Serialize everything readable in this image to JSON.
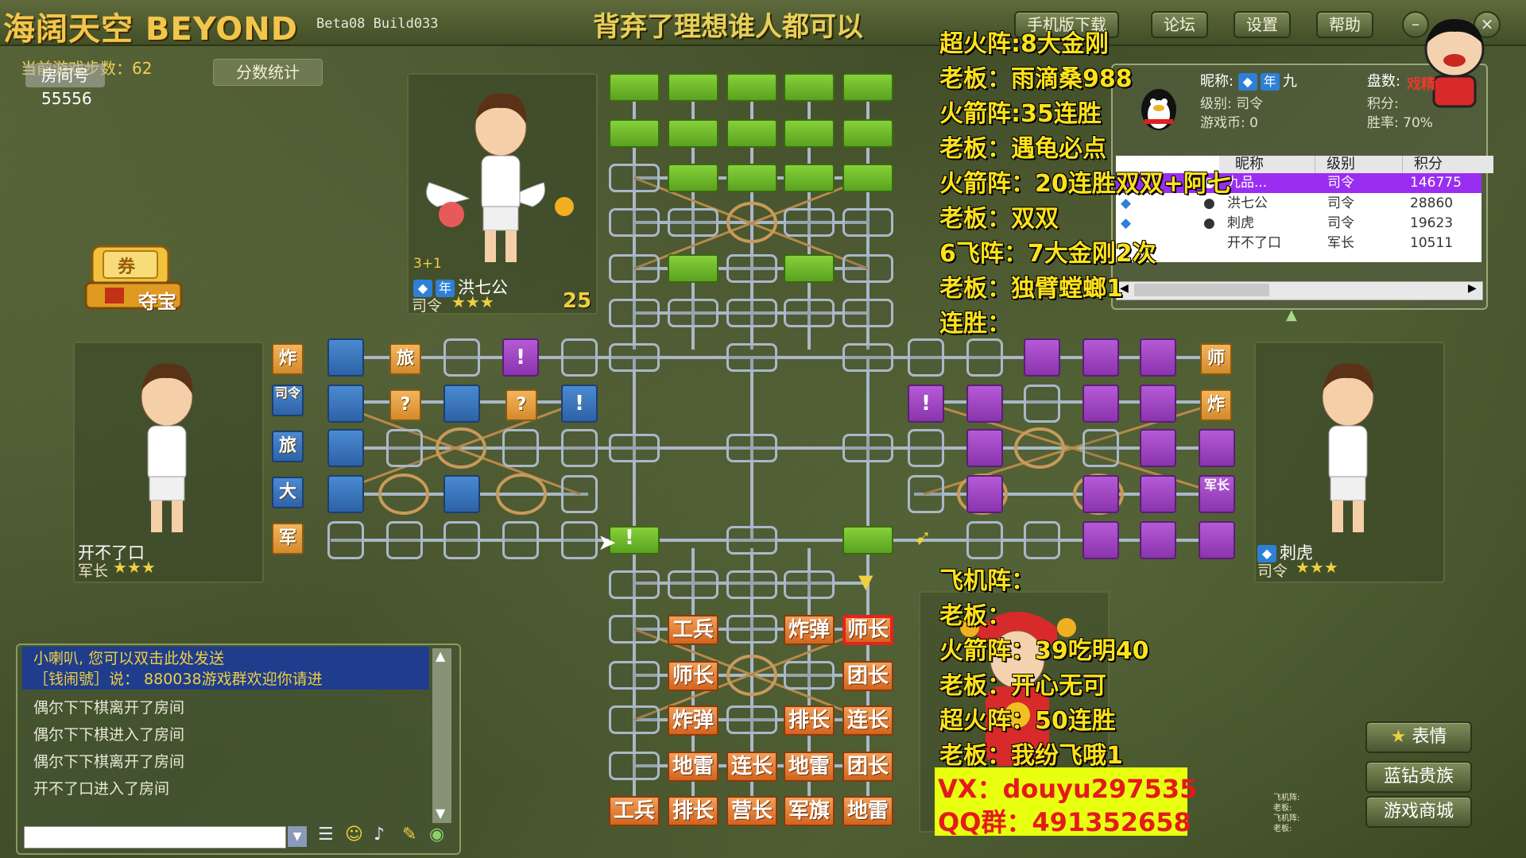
{
  "app": {
    "title": "海阔天空  BEYOND",
    "subtitle": "Beta08 Build033",
    "banner": "背弃了理想谁人都可以",
    "buttons": [
      "手机版下载",
      "论坛",
      "设置",
      "帮助"
    ]
  },
  "room": {
    "steps_label": "当前游戏步数：62",
    "room_label": "房间号",
    "room_number": "55556",
    "score_button": "分数统计",
    "treasure_label": "夺宝",
    "treasure_top": "券"
  },
  "players": {
    "top": {
      "name": "洪七公",
      "rank": "司令",
      "level": "3+1",
      "timer": "25",
      "badge": "年"
    },
    "left": {
      "name": "开不了口",
      "rank": "军长"
    },
    "right": {
      "name": "刺虎",
      "rank": "司令"
    }
  },
  "board": {
    "bottom_rows": [
      [
        "",
        "工兵",
        "",
        "炸弹",
        "师长"
      ],
      [
        "",
        "师长",
        "",
        "",
        "团长"
      ],
      [
        "",
        "炸弹",
        "",
        "排长",
        "连长"
      ],
      [
        "",
        "地雷",
        "连长",
        "地雷",
        "团长"
      ],
      [
        "工兵",
        "排长",
        "营长",
        "军旗",
        "地雷"
      ]
    ],
    "left_tiles": [
      "炸",
      "司令",
      "旅",
      "大",
      "军"
    ],
    "left_row1": [
      "旅",
      "!"
    ],
    "left_row2": [
      "?",
      "?",
      "!"
    ],
    "right_tiles": [
      "师",
      "炸",
      "",
      "军长"
    ],
    "right_mark": "!",
    "center_mark": "!"
  },
  "chat": {
    "line1": "小喇叭, 您可以双击此处发送",
    "line2": "［钱闹號］说：  880038游戏群欢迎你请进",
    "messages": [
      "偶尔下下棋离开了房间",
      "偶尔下下棋进入了房间",
      "偶尔下下棋离开了房间",
      "开不了口进入了房间"
    ]
  },
  "profile": {
    "nick_label": "昵称:",
    "nick_value": "九",
    "level_label": "级别: 司令",
    "coins_label": "游戏币: 0",
    "games_label": "盘数:",
    "score_label": "积分:",
    "winrate_label": "胜率: 70%"
  },
  "rank_table": {
    "headers": [
      "昵称",
      "级别",
      "积分"
    ],
    "rows": [
      {
        "name": "九品...",
        "level": "司令",
        "score": "146775"
      },
      {
        "name": "洪七公",
        "level": "司令",
        "score": "28860"
      },
      {
        "name": "刺虎",
        "level": "司令",
        "score": "19623"
      },
      {
        "name": "开不了口",
        "level": "军长",
        "score": "10511"
      }
    ]
  },
  "overlay": {
    "lines_top": [
      "超火阵:8大金刚",
      "老板：雨滴桑988",
      "火箭阵:35连胜",
      "老板：遇龟必点",
      "火箭阵：20连胜双双+阿七",
      "老板：双双",
      "6飞阵：7大金刚2次",
      "老板：独臂螳螂1",
      "连胜："
    ],
    "lines_bottom": [
      "飞机阵：",
      "老板：",
      "火箭阵：39吃明40",
      "老板：开心无可",
      "超火阵：50连胜",
      "老板：我纷飞哦1"
    ],
    "vx": "VX：douyu297535",
    "qq": "QQ群：491352658"
  },
  "side_buttons": [
    "表情",
    "蓝钻贵族",
    "游戏商城"
  ],
  "corner_mini": [
    "飞机阵:",
    "老板:",
    "飞机阵:",
    "老板:"
  ],
  "mascot_label": "戏精"
}
